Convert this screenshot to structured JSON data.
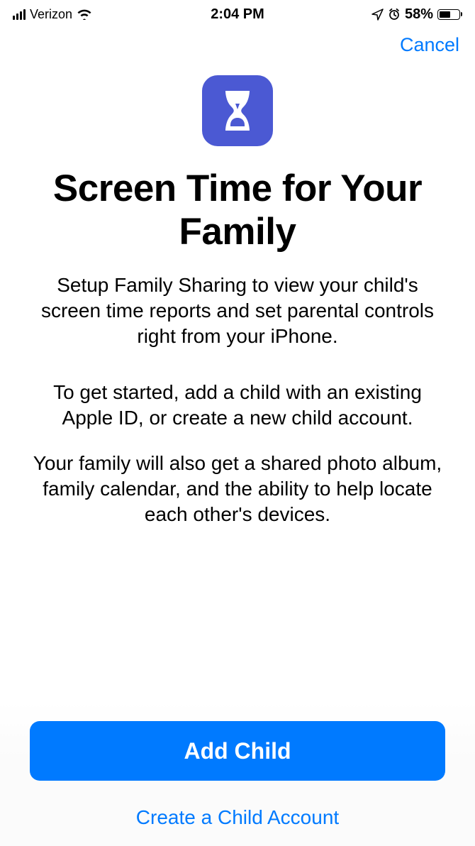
{
  "status_bar": {
    "carrier": "Verizon",
    "time": "2:04 PM",
    "battery_percent": "58%"
  },
  "nav": {
    "cancel_label": "Cancel"
  },
  "main": {
    "title": "Screen Time for Your Family",
    "paragraph_1": "Setup Family Sharing to view your child's screen time reports and set parental controls right from your iPhone.",
    "paragraph_2": "To get started, add a child with an existing Apple ID, or create a new child account.",
    "paragraph_3": "Your family will also get a shared photo album, family calendar, and the ability to help locate each other's devices."
  },
  "footer": {
    "primary_label": "Add Child",
    "link_label": "Create a Child Account"
  },
  "colors": {
    "accent": "#007aff",
    "badge": "#4b59d3"
  }
}
